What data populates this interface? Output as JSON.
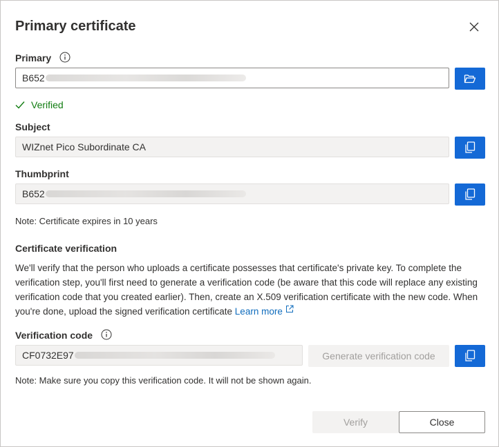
{
  "dialog": {
    "title": "Primary certificate",
    "close_icon": "close-icon"
  },
  "primary": {
    "label": "Primary",
    "info_icon": "info-icon",
    "value_visible": "B652",
    "browse_icon": "folder-open-icon"
  },
  "status": {
    "verified_text": "Verified",
    "verified_icon": "checkmark-icon",
    "color": "#107c10"
  },
  "subject": {
    "label": "Subject",
    "value": "WIZnet Pico Subordinate CA",
    "copy_icon": "copy-icon"
  },
  "thumbprint": {
    "label": "Thumbprint",
    "value_visible": "B652",
    "copy_icon": "copy-icon"
  },
  "expiry_note": "Note: Certificate expires in 10 years",
  "verification": {
    "section_title": "Certificate verification",
    "description": "We'll verify that the person who uploads a certificate possesses that certificate's private key. To complete the verification step, you'll first need to generate a verification code (be aware that this code will replace any existing verification code that you created earlier). Then, create an X.509 verification certificate with the new code. When you're done, upload the signed verification certificate",
    "learn_more": "Learn more",
    "external_link_icon": "external-link-icon",
    "code_label": "Verification code",
    "code_value_visible": "CF0732E97",
    "generate_label": "Generate verification code",
    "copy_icon": "copy-icon",
    "note": "Note: Make sure you copy this verification code. It will not be shown again."
  },
  "footer": {
    "verify_label": "Verify",
    "close_label": "Close"
  },
  "colors": {
    "accent": "#1469d6",
    "disabled_bg": "#f3f2f1",
    "disabled_text": "#a19f9d"
  }
}
